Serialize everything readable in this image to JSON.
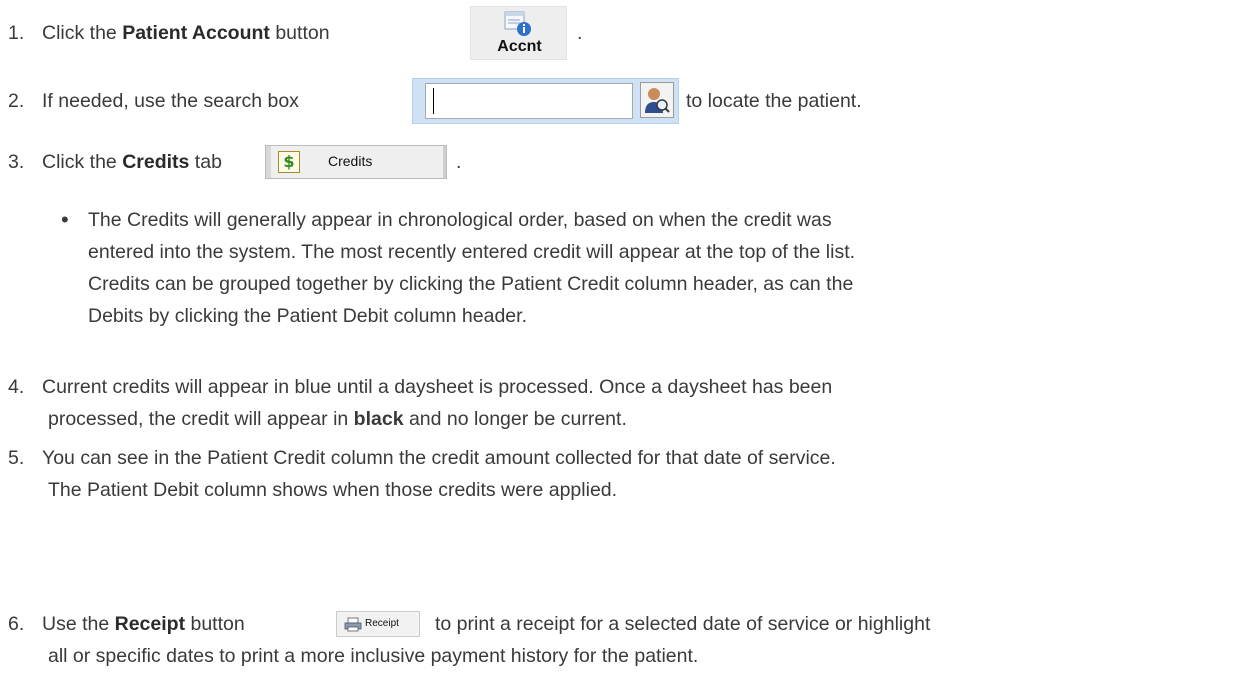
{
  "steps": {
    "s1": {
      "num": "1.",
      "pre": "Click the ",
      "bold": "Patient Account",
      "post": " button",
      "end": "."
    },
    "s2": {
      "num": "2.",
      "pre": "If needed, use the search box",
      "post": "to locate the patient."
    },
    "s3": {
      "num": "3.",
      "pre": "Click the ",
      "bold": "Credits",
      "post": " tab",
      "end": "."
    },
    "bullet": {
      "line1": "The Credits will generally appear in chronological order, based on when the credit was",
      "line2": "entered into the system. The most recently entered credit will appear at the top of the list.",
      "line3": "Credits can be grouped together by clicking the Patient Credit column header, as can the",
      "line4": "Debits by clicking the Patient Debit column header."
    },
    "s4": {
      "num": "4.",
      "line1": "Current credits will appear in blue until a daysheet is processed. Once a daysheet has been",
      "line2_pre": "processed, the credit will appear in ",
      "line2_bold": "black",
      "line2_post": " and no longer be current."
    },
    "s5": {
      "num": "5.",
      "line1": "You can see in the Patient Credit column the credit amount collected for that date of service.",
      "line2": "The Patient Debit column shows when those credits were applied."
    },
    "s6": {
      "num": "6.",
      "pre": "Use the ",
      "bold": "Receipt",
      "post1": " button",
      "post2": "to print a receipt for a selected date of service or highlight",
      "line2": "all or specific dates to print a more inclusive payment history for the patient."
    }
  },
  "ui": {
    "accnt_button_label": "Accnt",
    "credits_tab_label": "Credits",
    "credits_tab_icon_glyph": "$",
    "receipt_button_label": "Receipt",
    "icons": {
      "accnt": "patient-account-info-icon",
      "search": "patient-search-icon",
      "credits": "dollar-sign-icon",
      "receipt": "printer-icon"
    }
  }
}
